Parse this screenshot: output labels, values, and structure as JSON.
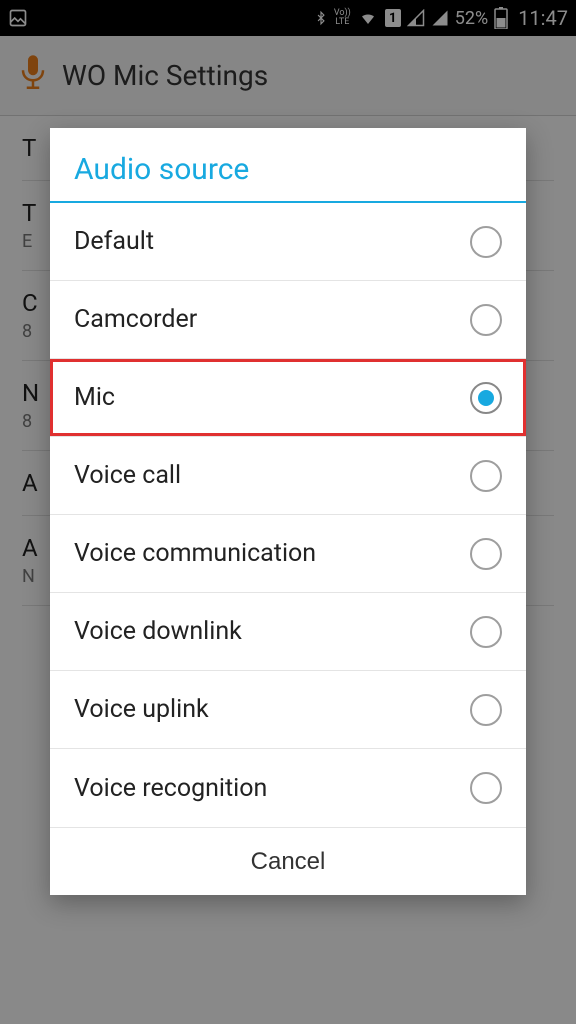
{
  "status": {
    "battery_pct": "52%",
    "time": "11:47",
    "volte": "Vo))\nLTE"
  },
  "app": {
    "title": "WO Mic Settings"
  },
  "bg_rows": [
    {
      "t": "T",
      "s": ""
    },
    {
      "t": "T",
      "s": "E"
    },
    {
      "t": "C",
      "s": "8"
    },
    {
      "t": "N",
      "s": "8"
    },
    {
      "t": "A",
      "s": ""
    },
    {
      "t": "A",
      "s": "N"
    }
  ],
  "dialog": {
    "title": "Audio source",
    "cancel": "Cancel",
    "options": [
      {
        "label": "Default",
        "selected": false,
        "highlight": false
      },
      {
        "label": "Camcorder",
        "selected": false,
        "highlight": false
      },
      {
        "label": "Mic",
        "selected": true,
        "highlight": true
      },
      {
        "label": "Voice call",
        "selected": false,
        "highlight": false
      },
      {
        "label": "Voice communication",
        "selected": false,
        "highlight": false
      },
      {
        "label": "Voice downlink",
        "selected": false,
        "highlight": false
      },
      {
        "label": "Voice uplink",
        "selected": false,
        "highlight": false
      },
      {
        "label": "Voice recognition",
        "selected": false,
        "highlight": false
      }
    ]
  }
}
